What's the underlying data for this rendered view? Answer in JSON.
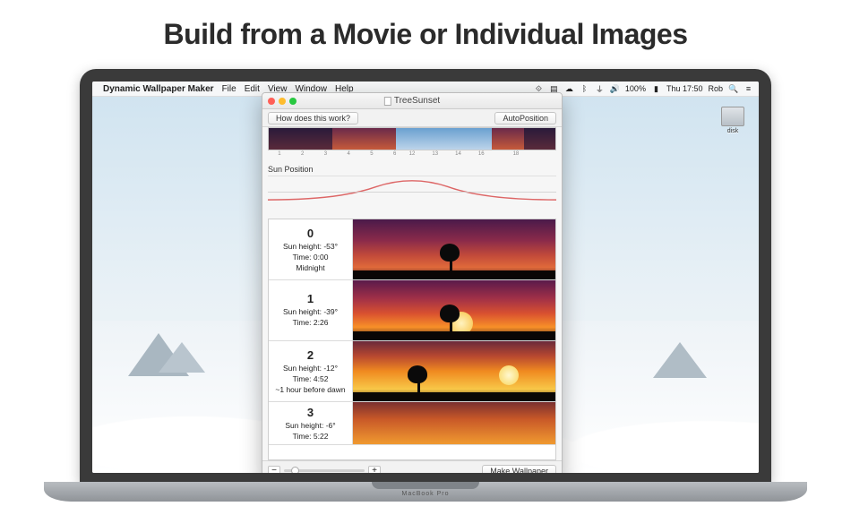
{
  "headline": "Build from a Movie or Individual Images",
  "laptop_model": "MacBook Pro",
  "menubar": {
    "app_name": "Dynamic Wallpaper Maker",
    "items": [
      "File",
      "Edit",
      "View",
      "Window",
      "Help"
    ],
    "status": {
      "battery": "100%",
      "time": "Thu 17:50",
      "user": "Rob"
    }
  },
  "desktop": {
    "disk_label": "disk"
  },
  "window": {
    "title": "TreeSunset",
    "how_btn": "How does this work?",
    "autopos_btn": "AutoPosition",
    "make_btn": "Make Wallpaper",
    "sun_position_label": "Sun Position",
    "frames": [
      {
        "index": "0",
        "sun_height": "Sun height: -53°",
        "time": "Time: 0:00",
        "note": "Midnight"
      },
      {
        "index": "1",
        "sun_height": "Sun height: -39°",
        "time": "Time: 2:26",
        "note": ""
      },
      {
        "index": "2",
        "sun_height": "Sun height: -12°",
        "time": "Time: 4:52",
        "note": "~1 hour before dawn"
      },
      {
        "index": "3",
        "sun_height": "Sun height: -6°",
        "time": "Time: 5:22",
        "note": ""
      }
    ]
  }
}
